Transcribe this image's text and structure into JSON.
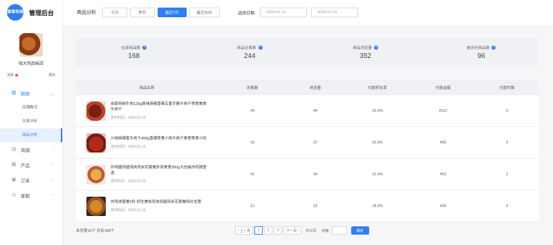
{
  "brand": {
    "logo_text": "津津有味",
    "title": "管理后台"
  },
  "store": {
    "name": "啃大鸡品味店",
    "action_left": "消息",
    "action_right": "退出"
  },
  "sidebar": {
    "groups": [
      {
        "label": "数据",
        "icon": "chart-icon",
        "active": true
      },
      {
        "label": "商铺",
        "icon": "store-icon"
      },
      {
        "label": "产品",
        "icon": "product-icon"
      },
      {
        "label": "订单",
        "icon": "order-icon"
      },
      {
        "label": "客服",
        "icon": "service-icon"
      }
    ],
    "sub_items": [
      "店铺概况",
      "交易分析",
      "商品分析"
    ]
  },
  "topbar": {
    "label": "商品分析",
    "ranges": [
      "今日",
      "昨日",
      "最近7日",
      "最近30日"
    ],
    "date_label": "选择日期",
    "date_start": "2020-01-13",
    "date_end": "2020-01-13"
  },
  "stats": [
    {
      "label": "在架商品数",
      "value": "168"
    },
    {
      "label": "商品访客数",
      "value": "244"
    },
    {
      "label": "商品浏览量",
      "value": "352"
    },
    {
      "label": "被访问商品数",
      "value": "96"
    }
  ],
  "table": {
    "headers": [
      "商品名称",
      "访客数",
      "浏览量",
      "付款转化率",
      "付款金额",
      "付款件数"
    ],
    "rows": [
      {
        "name": "自家特制牛肉120g原味麻辣香辣五香手撕牛肉干零食美食牛肉干",
        "time": "发布时间：2020-01-13",
        "visitors": "24",
        "views": "44",
        "rate": "15.0%",
        "amount": "¥112",
        "count": "5"
      },
      {
        "name": "川味麻辣香牛肉干400g香辣零食小吃牛肉干美食零食小吃",
        "time": "发布时间：2020-01-13",
        "visitors": "19",
        "views": "37",
        "rate": "20.0%",
        "amount": "¥93",
        "count": "3"
      },
      {
        "name": "炸鸡腿鸡翅鸡肉鸡米花套餐外卖美食300g大份装炸鸡随意选",
        "time": "发布时间：2020-01-13",
        "visitors": "16",
        "views": "34",
        "rate": "12.0%",
        "amount": "¥53",
        "count": "2"
      },
      {
        "name": "炸鸡块套餐2份 好吃美味鸡块鸡翅鸡米花套餐特价优惠",
        "time": "发布时间：2020-01-13",
        "visitors": "12",
        "views": "23",
        "rate": "18.0%",
        "amount": "¥30",
        "count": "3"
      }
    ]
  },
  "footer": {
    "summary": "本页第10个 共有168个",
    "prev": "上一页",
    "pages": [
      "1",
      "2",
      "3"
    ],
    "next": "下一页",
    "total_pages": "共10页",
    "goto": "到第",
    "confirm": "确定"
  }
}
